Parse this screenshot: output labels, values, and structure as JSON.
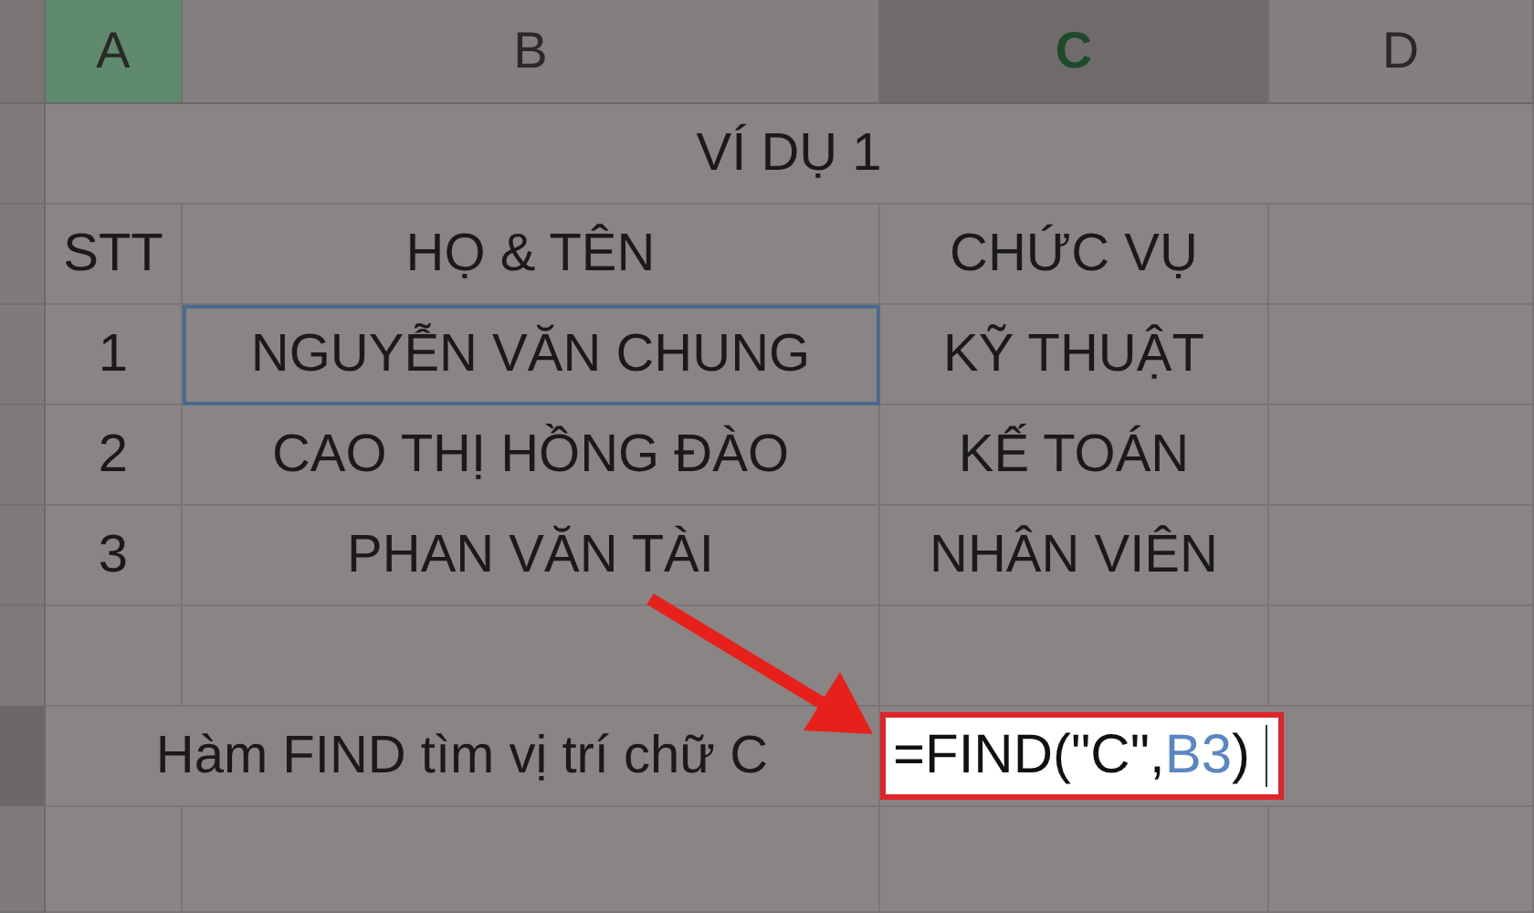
{
  "columns": [
    {
      "label": "A",
      "selected": true,
      "active": false
    },
    {
      "label": "B",
      "selected": false,
      "active": false
    },
    {
      "label": "C",
      "selected": false,
      "active": true
    },
    {
      "label": "D",
      "selected": false,
      "active": false
    }
  ],
  "title": "VÍ DỤ 1",
  "header": [
    "STT",
    "HỌ & TÊN",
    "CHỨC VỤ"
  ],
  "rows": [
    {
      "cells": [
        {
          "text": "1",
          "selected": false
        },
        {
          "text": "NGUYỄN VĂN CHUNG",
          "selected": true
        },
        {
          "text": "KỸ THUẬT",
          "selected": false
        }
      ]
    },
    {
      "cells": [
        {
          "text": "2",
          "selected": false
        },
        {
          "text": "CAO THỊ HỒNG ĐÀO",
          "selected": false
        },
        {
          "text": "KẾ TOÁN",
          "selected": false
        }
      ]
    },
    {
      "cells": [
        {
          "text": "3",
          "selected": false
        },
        {
          "text": "PHAN VĂN TÀI",
          "selected": false
        },
        {
          "text": "NHÂN VIÊN",
          "selected": false
        }
      ]
    }
  ],
  "formula_row": {
    "label": "Hàm FIND tìm vị trí chữ C",
    "formula": {
      "prefix": "=FIND(\"C\",",
      "ref": "B3",
      "suffix": ")"
    }
  }
}
